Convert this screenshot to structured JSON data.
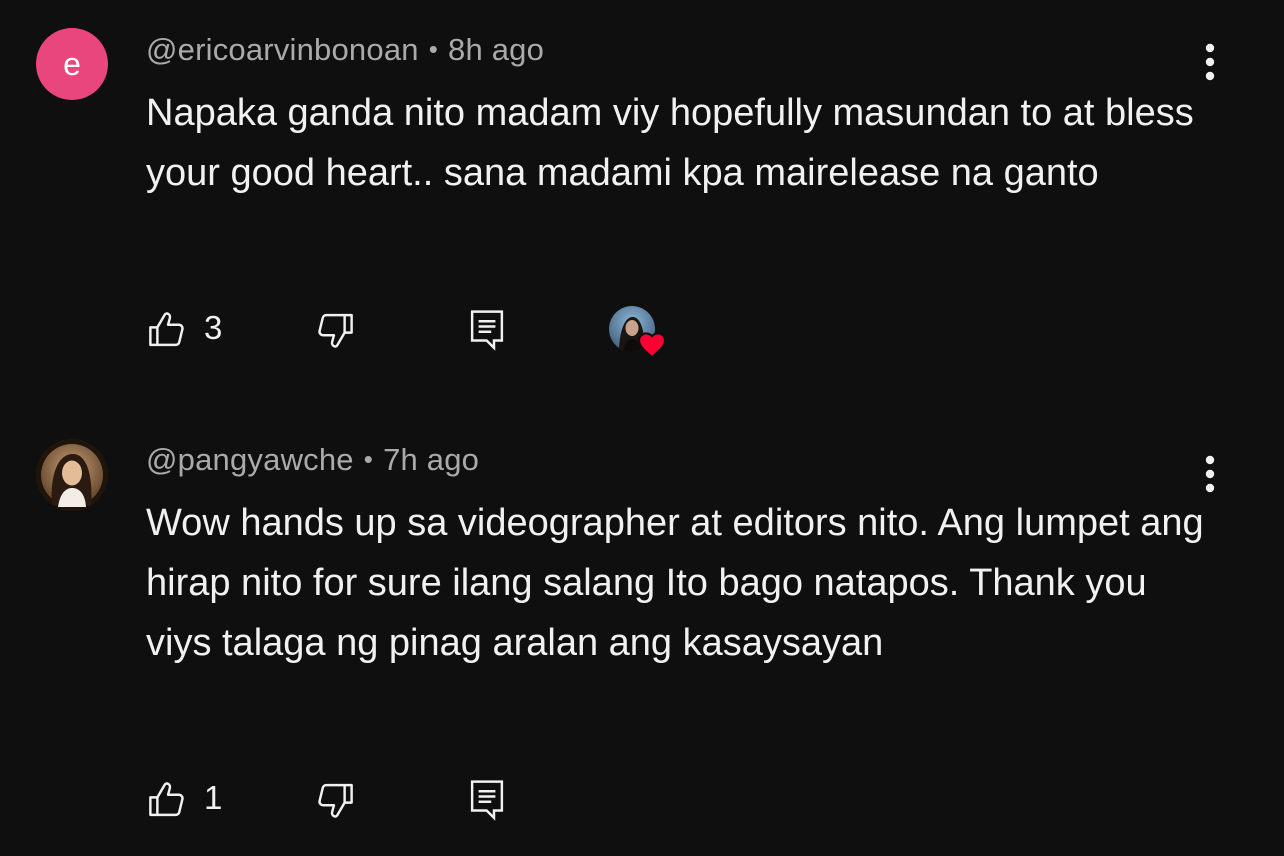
{
  "comments": [
    {
      "avatar_letter": "e",
      "avatar_color": "#e8467c",
      "username": "@ericoarvinbonoan",
      "separator": "•",
      "time": "8h ago",
      "text": "Napaka ganda nito madam viy hopefully masundan to at bless your good heart.. sana madami kpa mairelease na ganto",
      "like_count": "3",
      "icons": {
        "like": "thumbs-up-icon",
        "dislike": "thumbs-down-icon",
        "reply": "reply-comment-icon",
        "more": "more-vertical-icon",
        "hearted": "creator-heart-icon"
      },
      "hearted_by_creator": true
    },
    {
      "username": "@pangyawche",
      "separator": "•",
      "time": "7h ago",
      "text": "Wow hands up sa videographer at editors nito. Ang lumpet ang hirap nito for sure ilang salang Ito bago natapos. Thank you viys talaga ng pinag aralan ang kasaysayan",
      "like_count": "1",
      "icons": {
        "like": "thumbs-up-icon",
        "dislike": "thumbs-down-icon",
        "reply": "reply-comment-icon",
        "more": "more-vertical-icon"
      },
      "hearted_by_creator": false
    }
  ],
  "theme": {
    "background": "#0f0f0f",
    "primary_text": "#f1f1f1",
    "secondary_text": "#aaaaaa",
    "heart": "#ff0033"
  }
}
